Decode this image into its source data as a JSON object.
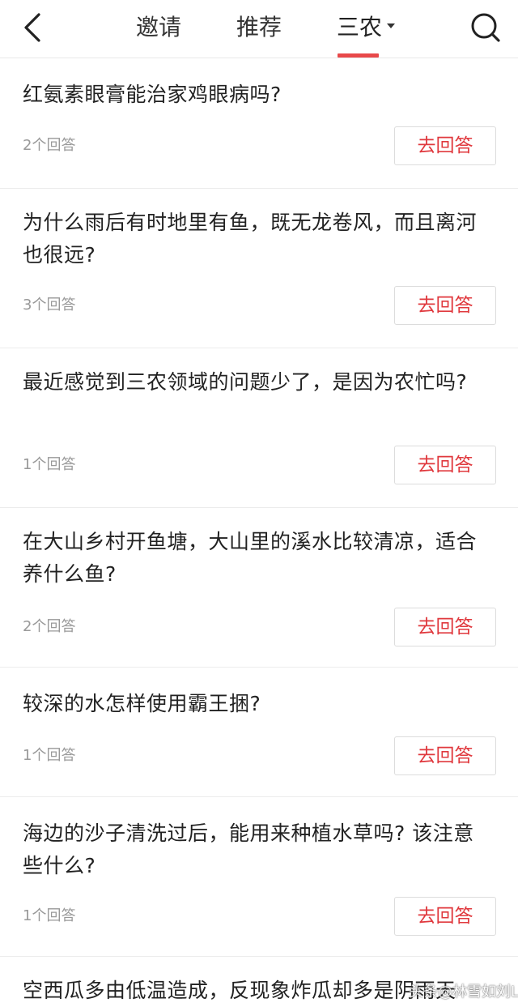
{
  "header": {
    "tabs": [
      {
        "label": "邀请"
      },
      {
        "label": "推荐"
      },
      {
        "label": "三农"
      }
    ]
  },
  "questions": [
    {
      "title": "红氨素眼膏能治家鸡眼病吗?",
      "answers": "2个回答",
      "action": "去回答"
    },
    {
      "title": "为什么雨后有时地里有鱼，既无龙卷风，而且离河也很远?",
      "answers": "3个回答",
      "action": "去回答"
    },
    {
      "title": "最近感觉到三农领域的问题少了，是因为农忙吗?",
      "answers": "1个回答",
      "action": "去回答"
    },
    {
      "title": "在大山乡村开鱼塘，大山里的溪水比较清凉，适合养什么鱼?",
      "answers": "2个回答",
      "action": "去回答"
    },
    {
      "title": "较深的水怎样使用霸王捆?",
      "answers": "1个回答",
      "action": "去回答"
    },
    {
      "title": "海边的沙子清洗过后，能用来种植水草吗? 该注意些什么?",
      "answers": "1个回答",
      "action": "去回答"
    },
    {
      "title": "空西瓜多由低温造成，反现象炸瓜却多是阴雨天",
      "answers": "",
      "action": ""
    }
  ],
  "watermark": "头条@林雪如刘L",
  "colors": {
    "accent": "#e8494a",
    "answer_text": "#e0393e"
  }
}
